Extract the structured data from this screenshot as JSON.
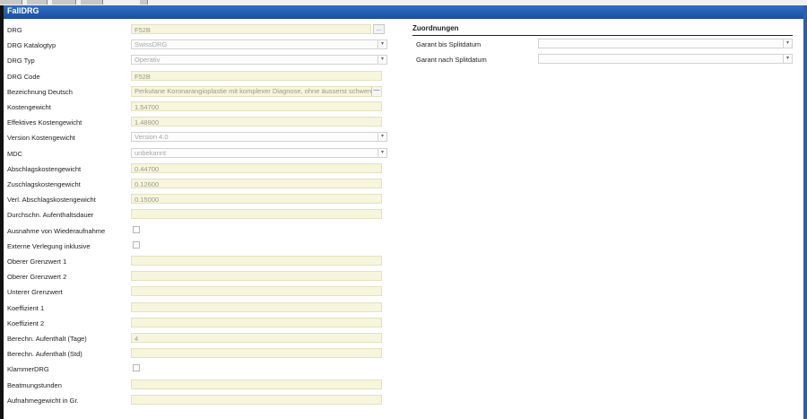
{
  "window": {
    "title": "FallDRG"
  },
  "left_fields": [
    {
      "label": "DRG",
      "type": "text-ellipsis",
      "value": "F52B"
    },
    {
      "label": "DRG Katalogtyp",
      "type": "select",
      "value": "SwissDRG"
    },
    {
      "label": "DRG Typ",
      "type": "select",
      "value": "Operativ"
    },
    {
      "label": "DRG Code",
      "type": "text",
      "value": "F52B"
    },
    {
      "label": "Bezeichnung Deutsch",
      "type": "textarea",
      "value": "Perkutane Koronarangioplastie mit komplexer Diagnose, ohne äusserst schwere"
    },
    {
      "label": "Kostengewicht",
      "type": "text",
      "value": "1.54700"
    },
    {
      "label": "Effektives Kostengewicht",
      "type": "text",
      "value": "1.48900"
    },
    {
      "label": "Version Kostengewicht",
      "type": "select",
      "value": "Version 4.0"
    },
    {
      "label": "MDC",
      "type": "select",
      "value": "unbekannt"
    },
    {
      "label": "Abschlagskostengewicht",
      "type": "text",
      "value": "0.44700"
    },
    {
      "label": "Zuschlagskostengewicht",
      "type": "text",
      "value": "0.12600"
    },
    {
      "label": "Verl. Abschlagskostengewicht",
      "type": "text",
      "value": "0.15000"
    },
    {
      "label": "Durchschn. Aufenthaltsdauer",
      "type": "text",
      "value": ""
    },
    {
      "label": "Ausnahme von Wiederaufnahme",
      "type": "checkbox",
      "value": ""
    },
    {
      "label": "Externe Verlegung inklusive",
      "type": "checkbox",
      "value": ""
    },
    {
      "label": "Oberer Grenzwert 1",
      "type": "text",
      "value": ""
    },
    {
      "label": "Oberer Grenzwert 2",
      "type": "text",
      "value": ""
    },
    {
      "label": "Unterer Grenzwert",
      "type": "text",
      "value": ""
    },
    {
      "label": "Koeffizient 1",
      "type": "text",
      "value": ""
    },
    {
      "label": "Koeffizient 2",
      "type": "text",
      "value": ""
    },
    {
      "label": "Berechn. Aufenthalt (Tage)",
      "type": "text",
      "value": "4"
    },
    {
      "label": "Berechn. Aufenthalt (Std)",
      "type": "text",
      "value": ""
    },
    {
      "label": "KlammerDRG",
      "type": "checkbox",
      "value": ""
    },
    {
      "label": "Beatmungstunden",
      "type": "text",
      "value": ""
    },
    {
      "label": "Aufnahmegewicht in Gr.",
      "type": "text",
      "value": ""
    }
  ],
  "right_section": {
    "title": "Zuordnungen",
    "fields": [
      {
        "label": "Garant bis Splitdatum",
        "value": ""
      },
      {
        "label": "Garant nach Splitdatum",
        "value": ""
      }
    ]
  },
  "icons": {
    "ellipsis": "…",
    "dropdown": "▾",
    "textarea_button": "—"
  }
}
